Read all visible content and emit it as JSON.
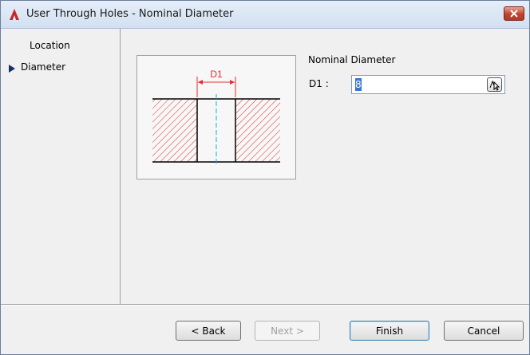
{
  "window": {
    "title": "User Through Holes - Nominal Diameter"
  },
  "sidebar": {
    "items": [
      {
        "label": "Location",
        "active": false
      },
      {
        "label": "Diameter",
        "active": true
      }
    ]
  },
  "diagram": {
    "dimension_label": "D1"
  },
  "form": {
    "group_label": "Nominal Diameter",
    "d1_label": "D1 :",
    "d1_value": "8"
  },
  "buttons": {
    "back": "< Back",
    "next": "Next >",
    "finish": "Finish",
    "cancel": "Cancel"
  },
  "colors": {
    "hatch": "#e03030",
    "accent_arrow": "#1a2e6e",
    "center_line": "#00b4e6"
  }
}
